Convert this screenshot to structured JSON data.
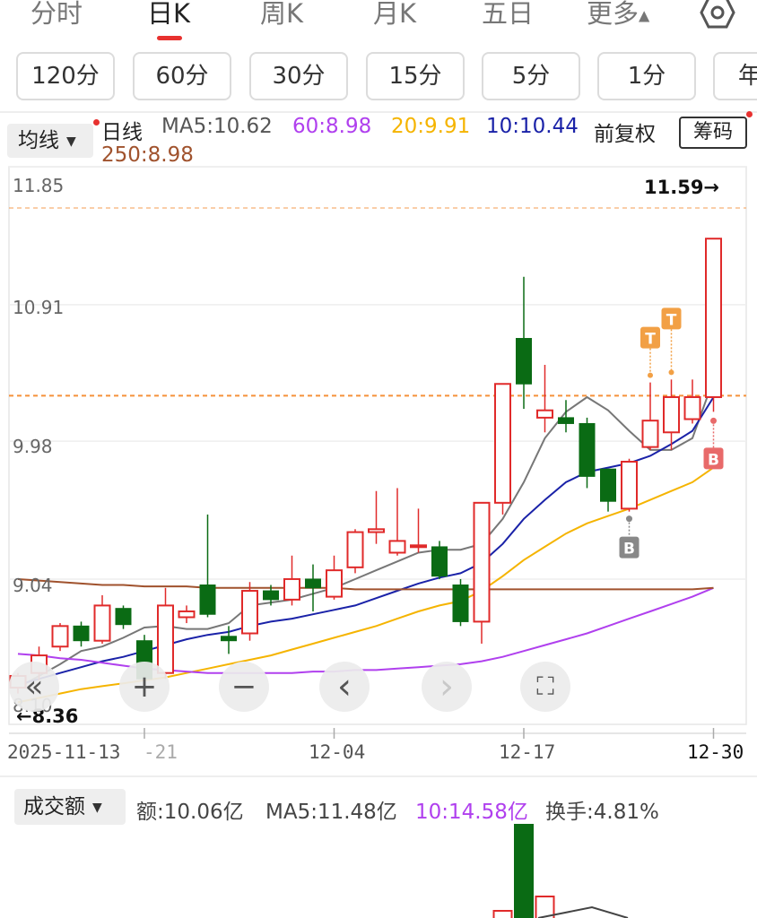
{
  "tabs": {
    "items": [
      "分时",
      "日K",
      "周K",
      "月K",
      "五日",
      "更多"
    ],
    "active_index": 1
  },
  "periods": [
    "120分",
    "60分",
    "30分",
    "15分",
    "5分",
    "1分",
    "年"
  ],
  "legend": {
    "ma_select_label": "均线",
    "daily": "日线",
    "ma5": "MA5:10.62",
    "ma60": "60:8.98",
    "ma20": "20:9.91",
    "ma10": "10:10.44",
    "ma250": "250:8.98",
    "adjust_label": "前复权",
    "chip_button": "筹码"
  },
  "colors": {
    "up": "#e02a2a",
    "down": "#0a6b14",
    "ma5": "#777777",
    "ma10": "#1a22a8",
    "ma20": "#f5b400",
    "ma60": "#b040ee",
    "ma250": "#a0522d",
    "signal_t": "#f2a045",
    "signal_b_sell": "#e86a6a",
    "signal_b_buy": "#888888",
    "reference_line": "#f5913a"
  },
  "chart_data": {
    "type": "candlestick",
    "y_ticks": [
      "11.85",
      "10.91",
      "9.98",
      "9.04"
    ],
    "y_bottom_label": "8.10",
    "x_labels": [
      "2025-11-13",
      "-21",
      "12-04",
      "12-17",
      "12-30"
    ],
    "high_label": "11.59→",
    "low_label": "←8.36",
    "ylim": [
      8.05,
      11.85
    ],
    "reference_price": 10.29,
    "candles": [
      {
        "o": 8.3,
        "c": 8.38,
        "h": 8.4,
        "l": 8.26
      },
      {
        "o": 8.4,
        "c": 8.52,
        "h": 8.58,
        "l": 8.35
      },
      {
        "o": 8.58,
        "c": 8.72,
        "h": 8.74,
        "l": 8.55
      },
      {
        "o": 8.72,
        "c": 8.62,
        "h": 8.75,
        "l": 8.58
      },
      {
        "o": 8.62,
        "c": 8.86,
        "h": 8.93,
        "l": 8.6
      },
      {
        "o": 8.84,
        "c": 8.73,
        "h": 8.86,
        "l": 8.7
      },
      {
        "o": 8.62,
        "c": 8.36,
        "h": 8.66,
        "l": 8.32
      },
      {
        "o": 8.4,
        "c": 8.86,
        "h": 8.98,
        "l": 8.36
      },
      {
        "o": 8.78,
        "c": 8.82,
        "h": 8.86,
        "l": 8.74
      },
      {
        "o": 9.0,
        "c": 8.8,
        "h": 9.48,
        "l": 8.78
      },
      {
        "o": 8.65,
        "c": 8.62,
        "h": 8.72,
        "l": 8.53
      },
      {
        "o": 8.67,
        "c": 8.96,
        "h": 9.02,
        "l": 8.62
      },
      {
        "o": 8.96,
        "c": 8.9,
        "h": 9.0,
        "l": 8.86
      },
      {
        "o": 8.9,
        "c": 9.04,
        "h": 9.2,
        "l": 8.86
      },
      {
        "o": 9.04,
        "c": 8.98,
        "h": 9.14,
        "l": 8.82
      },
      {
        "o": 8.92,
        "c": 9.1,
        "h": 9.2,
        "l": 8.9
      },
      {
        "o": 9.12,
        "c": 9.36,
        "h": 9.38,
        "l": 9.08
      },
      {
        "o": 9.36,
        "c": 9.38,
        "h": 9.64,
        "l": 9.28
      },
      {
        "o": 9.22,
        "c": 9.3,
        "h": 9.66,
        "l": 9.2
      },
      {
        "o": 9.27,
        "c": 9.27,
        "h": 9.52,
        "l": 9.22
      },
      {
        "o": 9.26,
        "c": 9.06,
        "h": 9.3,
        "l": 9.04
      },
      {
        "o": 9.0,
        "c": 8.75,
        "h": 9.04,
        "l": 8.72
      },
      {
        "o": 8.75,
        "c": 9.56,
        "h": 9.56,
        "l": 8.6
      },
      {
        "o": 9.56,
        "c": 10.37,
        "h": 10.37,
        "l": 9.48
      },
      {
        "o": 10.68,
        "c": 10.37,
        "h": 11.1,
        "l": 10.2
      },
      {
        "o": 10.14,
        "c": 10.19,
        "h": 10.5,
        "l": 10.04
      },
      {
        "o": 10.14,
        "c": 10.1,
        "h": 10.26,
        "l": 10.04
      },
      {
        "o": 10.1,
        "c": 9.74,
        "h": 10.14,
        "l": 9.66
      },
      {
        "o": 9.79,
        "c": 9.57,
        "h": 9.79,
        "l": 9.5
      },
      {
        "o": 9.52,
        "c": 9.84,
        "h": 9.86,
        "l": 9.5
      },
      {
        "o": 9.94,
        "c": 10.12,
        "h": 10.38,
        "l": 9.92
      },
      {
        "o": 10.04,
        "c": 10.28,
        "h": 10.4,
        "l": 9.92
      },
      {
        "o": 10.13,
        "c": 10.28,
        "h": 10.4,
        "l": 10.1
      },
      {
        "o": 10.28,
        "c": 11.36,
        "h": 11.36,
        "l": 10.18
      }
    ],
    "series": [
      {
        "name": "MA5",
        "values": [
          8.3,
          8.38,
          8.46,
          8.55,
          8.58,
          8.64,
          8.71,
          8.72,
          8.7,
          8.7,
          8.74,
          8.86,
          8.88,
          8.9,
          8.94,
          8.98,
          9.04,
          9.1,
          9.16,
          9.22,
          9.24,
          9.24,
          9.28,
          9.45,
          9.7,
          10.0,
          10.18,
          10.28,
          10.19,
          10.05,
          9.92,
          9.92,
          10.0,
          10.4
        ]
      },
      {
        "name": "MA10",
        "values": [
          8.32,
          8.36,
          8.4,
          8.44,
          8.48,
          8.51,
          8.55,
          8.59,
          8.63,
          8.66,
          8.68,
          8.72,
          8.75,
          8.77,
          8.8,
          8.83,
          8.86,
          8.91,
          8.96,
          9.01,
          9.05,
          9.08,
          9.15,
          9.28,
          9.45,
          9.58,
          9.7,
          9.77,
          9.8,
          9.83,
          9.88,
          9.96,
          10.05,
          10.28
        ]
      },
      {
        "name": "MA20",
        "values": [
          8.2,
          8.23,
          8.26,
          8.29,
          8.31,
          8.33,
          8.35,
          8.37,
          8.4,
          8.43,
          8.46,
          8.49,
          8.52,
          8.56,
          8.6,
          8.64,
          8.68,
          8.72,
          8.77,
          8.82,
          8.86,
          8.89,
          8.96,
          9.06,
          9.17,
          9.26,
          9.35,
          9.42,
          9.47,
          9.52,
          9.58,
          9.64,
          9.7,
          9.8
        ]
      },
      {
        "name": "MA60",
        "values": [
          8.53,
          8.52,
          8.5,
          8.49,
          8.47,
          8.45,
          8.43,
          8.42,
          8.41,
          8.4,
          8.4,
          8.4,
          8.4,
          8.4,
          8.41,
          8.41,
          8.42,
          8.42,
          8.43,
          8.44,
          8.45,
          8.46,
          8.48,
          8.51,
          8.55,
          8.59,
          8.63,
          8.67,
          8.72,
          8.77,
          8.82,
          8.87,
          8.92,
          8.98
        ]
      },
      {
        "name": "MA250",
        "values": [
          9.04,
          9.03,
          9.02,
          9.01,
          9.0,
          9.0,
          8.99,
          8.99,
          8.99,
          8.98,
          8.98,
          8.98,
          8.98,
          8.98,
          8.98,
          8.98,
          8.97,
          8.97,
          8.97,
          8.97,
          8.97,
          8.97,
          8.97,
          8.97,
          8.97,
          8.97,
          8.97,
          8.97,
          8.97,
          8.97,
          8.97,
          8.97,
          8.97,
          8.98
        ]
      }
    ],
    "signals": [
      {
        "label": "T",
        "index": 30,
        "kind": "t"
      },
      {
        "label": "T",
        "index": 31,
        "kind": "t"
      },
      {
        "label": "B",
        "index": 29,
        "kind": "buy"
      },
      {
        "label": "B",
        "index": 33,
        "kind": "sell"
      }
    ]
  },
  "controls": [
    "«",
    "+",
    "−",
    "‹",
    "›",
    "⛶"
  ],
  "volume": {
    "select_label": "成交额",
    "amount": "额:10.06亿",
    "ma5": "MA5:11.48亿",
    "ma10": "10:14.58亿",
    "turnover": "换手:4.81%"
  }
}
